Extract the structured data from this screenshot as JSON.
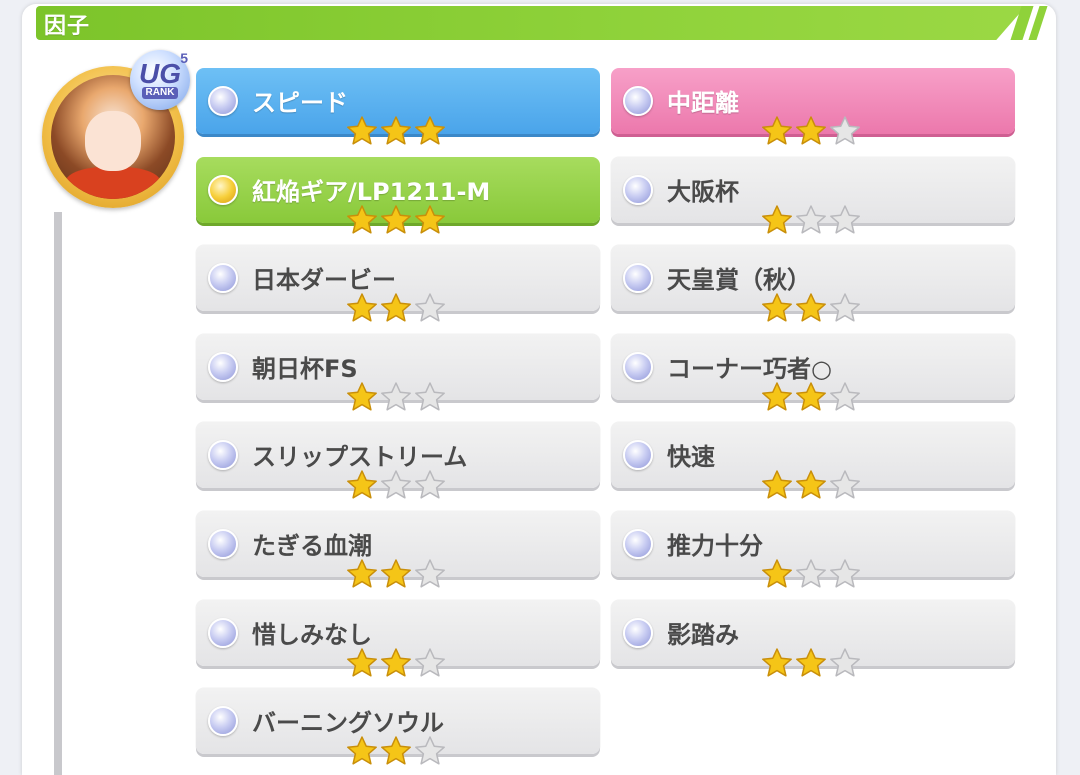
{
  "header": {
    "title": "因子"
  },
  "profile": {
    "rank_letters": "UG",
    "rank_number": "5",
    "rank_label": "RANK"
  },
  "factors_left": [
    {
      "label": "スピード",
      "stars": 3,
      "style": "blue"
    },
    {
      "label": "紅焔ギア/LP1211-M",
      "stars": 3,
      "style": "green"
    },
    {
      "label": "日本ダービー",
      "stars": 2,
      "style": "normal"
    },
    {
      "label": "朝日杯FS",
      "stars": 1,
      "style": "normal"
    },
    {
      "label": "スリップストリーム",
      "stars": 1,
      "style": "normal"
    },
    {
      "label": "たぎる血潮",
      "stars": 2,
      "style": "normal"
    },
    {
      "label": "惜しみなし",
      "stars": 2,
      "style": "normal"
    },
    {
      "label": "バーニングソウル",
      "stars": 2,
      "style": "normal"
    }
  ],
  "factors_right": [
    {
      "label": "中距離",
      "stars": 2,
      "style": "pink"
    },
    {
      "label": "大阪杯",
      "stars": 1,
      "style": "normal"
    },
    {
      "label": "天皇賞（秋）",
      "stars": 2,
      "style": "normal"
    },
    {
      "label": "コーナー巧者○",
      "stars": 2,
      "style": "normal"
    },
    {
      "label": "快速",
      "stars": 2,
      "style": "normal"
    },
    {
      "label": "推力十分",
      "stars": 1,
      "style": "normal"
    },
    {
      "label": "影踏み",
      "stars": 2,
      "style": "normal"
    }
  ],
  "colors": {
    "header_green": "#8fd23a",
    "blue_factor": "#4aa4ea",
    "pink_factor": "#ec78ac",
    "green_factor": "#89c93a",
    "star_gold": "#f5c517",
    "star_empty": "#e6e6e6"
  }
}
